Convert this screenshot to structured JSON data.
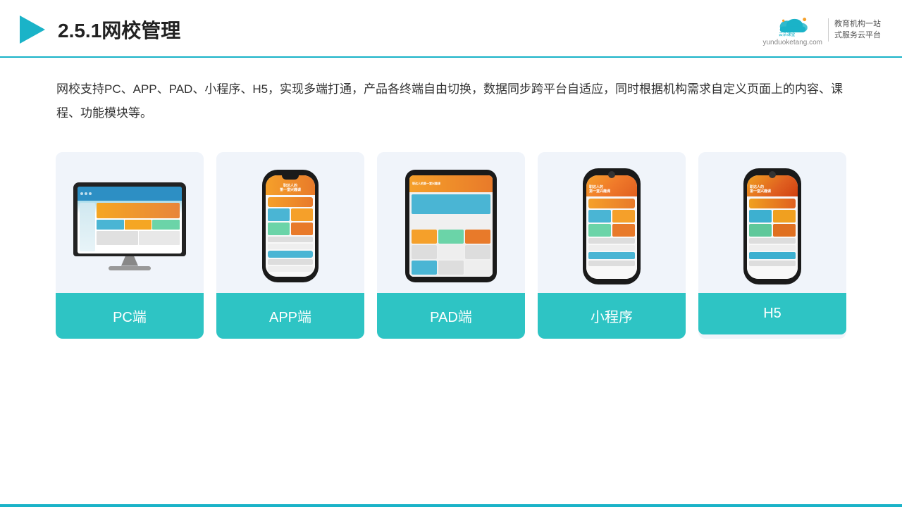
{
  "header": {
    "title": "2.5.1网校管理",
    "logo_url": "yunduoketang.com",
    "logo_tagline_1": "教育机构一站",
    "logo_tagline_2": "式服务云平台"
  },
  "description": {
    "text": "网校支持PC、APP、PAD、小程序、H5，实现多端打通，产品各终端自由切换，数据同步跨平台自适应，同时根据机构需求自定义页面上的内容、课程、功能模块等。"
  },
  "cards": [
    {
      "id": "pc",
      "label": "PC端"
    },
    {
      "id": "app",
      "label": "APP端"
    },
    {
      "id": "pad",
      "label": "PAD端"
    },
    {
      "id": "mini",
      "label": "小程序"
    },
    {
      "id": "h5",
      "label": "H5"
    }
  ],
  "colors": {
    "teal": "#2ec4c4",
    "accent": "#1ab3c8",
    "orange": "#f5a02a",
    "dark": "#1a1a1a",
    "light_bg": "#f0f4fa"
  }
}
